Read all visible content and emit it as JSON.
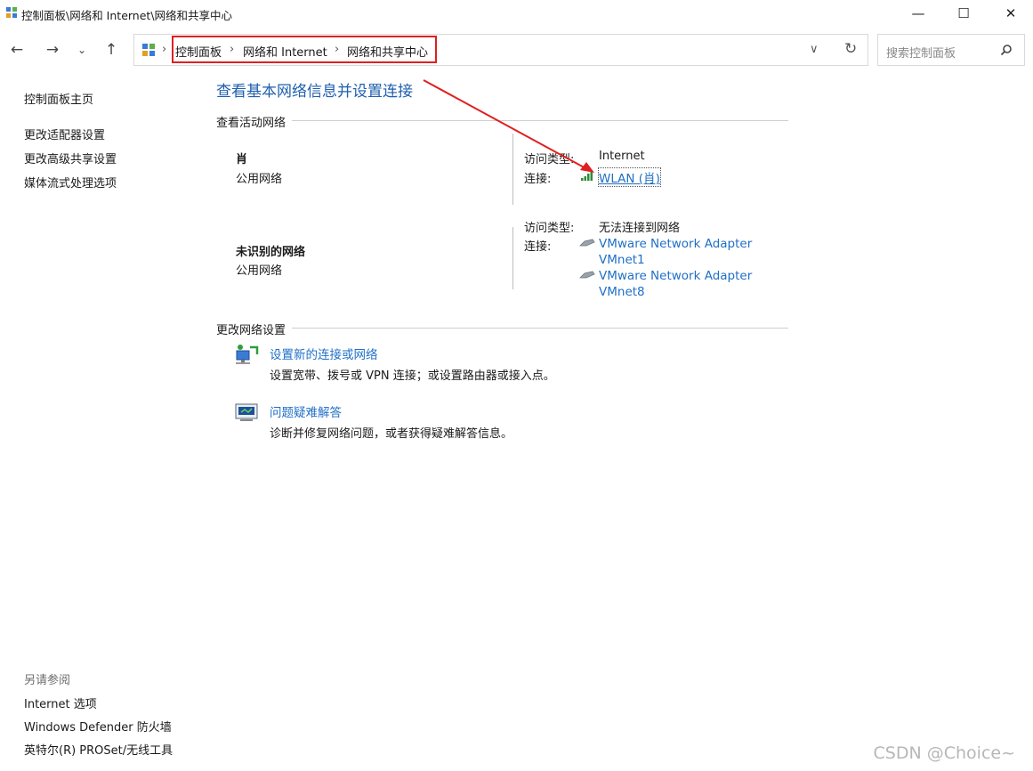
{
  "window": {
    "title": "控制面板\\网络和 Internet\\网络和共享中心",
    "minimize": "—",
    "maximize": "☐",
    "close": "✕"
  },
  "nav": {
    "back": "←",
    "forward": "→",
    "recent": "⌄",
    "up": "↑",
    "breadcrumb": [
      "控制面板",
      "网络和 Internet",
      "网络和共享中心"
    ],
    "sep": "›",
    "dropdown": "∨",
    "refresh": "↻",
    "search_placeholder": "搜索控制面板"
  },
  "sidebar": {
    "home": "控制面板主页",
    "links": [
      "更改适配器设置",
      "更改高级共享设置",
      "媒体流式处理选项"
    ],
    "see_also_title": "另请参阅",
    "see_also": [
      "Internet 选项",
      "Windows Defender 防火墙",
      "英特尔(R) PROSet/无线工具"
    ]
  },
  "main": {
    "heading": "查看基本网络信息并设置连接",
    "active_title": "查看活动网络",
    "networks": [
      {
        "name": "肖",
        "type": "公用网络",
        "access_label": "访问类型:",
        "access_value": "Internet",
        "conn_label": "连接:",
        "connections": [
          "WLAN (肖)"
        ]
      },
      {
        "name": "未识别的网络",
        "type": "公用网络",
        "access_label": "访问类型:",
        "access_value": "无法连接到网络",
        "conn_label": "连接:",
        "connections": [
          "VMware Network Adapter",
          "VMnet1",
          "VMware Network Adapter",
          "VMnet8"
        ]
      }
    ],
    "change_title": "更改网络设置",
    "tasks": [
      {
        "link": "设置新的连接或网络",
        "desc": "设置宽带、拨号或 VPN 连接；或设置路由器或接入点。"
      },
      {
        "link": "问题疑难解答",
        "desc": "诊断并修复网络问题，或者获得疑难解答信息。"
      }
    ]
  },
  "watermark": "CSDN @Choice~",
  "colors": {
    "link": "#1f6fc7",
    "heading": "#1f5fae",
    "annotation": "#e02020"
  },
  "icons": [
    "control-panel-icon",
    "wifi-signal-icon",
    "network-cable-icon",
    "new-connection-icon",
    "troubleshoot-icon",
    "search-icon"
  ]
}
